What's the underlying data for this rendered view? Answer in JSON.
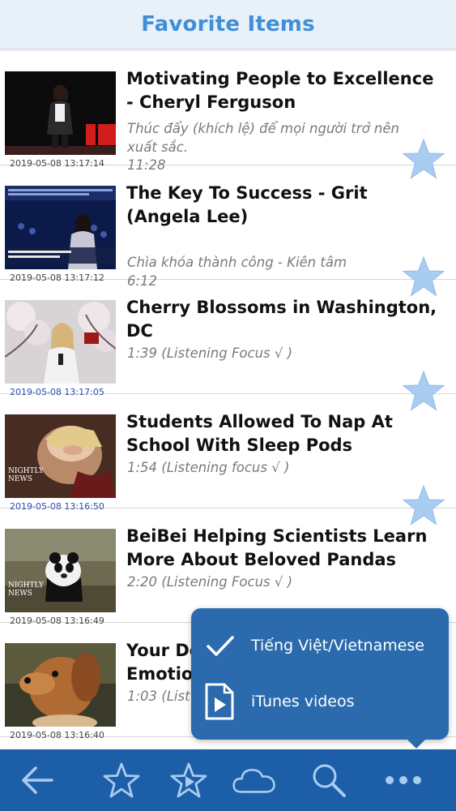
{
  "header": {
    "title": "Favorite Items"
  },
  "items": [
    {
      "title": "Motivating People to Excellence - Cheryl Ferguson",
      "subtitle": "Thúc đẩy (khích lệ) để mọi người trở nên xuất sắc.",
      "duration": "11:28",
      "date": "2019-05-08 13:17:14",
      "date_color": "gray",
      "thumbnail": "ted-speaker-red-stage"
    },
    {
      "title": "The Key To Success - Grit (Angela Lee)",
      "subtitle": "Chìa khóa thành công - Kiên tâm",
      "duration": "6:12",
      "date": "2019-05-08 13:17:12",
      "date_color": "gray",
      "thumbnail": "ted-speaker-blue-stage"
    },
    {
      "title": "Cherry Blossoms in Washington, DC",
      "subtitle": "1:39 (Listening Focus  √ )",
      "date": "2019-05-08 13:17:05",
      "date_color": "blue",
      "thumbnail": "reporter-cherry-blossoms"
    },
    {
      "title": "Students Allowed To Nap At School With Sleep Pods",
      "subtitle": "1:54 (Listening focus  √ )",
      "date": "2019-05-08 13:16:50",
      "date_color": "blue",
      "thumbnail": "student-sleep-pod",
      "logo_text": [
        "NIGHTLY",
        "NEWS"
      ]
    },
    {
      "title": "BeiBei Helping Scientists Learn More About Beloved Pandas",
      "subtitle": "2:20 (Listening Focus  √ )",
      "date": "2019-05-08 13:16:49",
      "date_color": "gray",
      "thumbnail": "panda",
      "logo_text": [
        "NIGHTLY",
        "NEWS"
      ]
    },
    {
      "title": "Your Do",
      "title_line2": "Emotio",
      "subtitle": "1:03 (List",
      "date": "2019-05-08 13:16:40",
      "date_color": "gray",
      "thumbnail": "dog"
    }
  ],
  "popover": {
    "items": [
      {
        "label": "Tiếng Việt/Vietnamese",
        "icon": "checkmark-icon"
      },
      {
        "label": "iTunes videos",
        "icon": "video-file-icon"
      }
    ]
  },
  "toolbar": {
    "buttons": [
      "back-arrow-icon",
      "star-outline-icon",
      "star-play-icon",
      "cloud-icon",
      "search-icon",
      "more-icon"
    ]
  },
  "colors": {
    "header_title": "#3f8fd8",
    "star_fill": "#a9cdf0",
    "toolbar_bg": "#1c5fa8",
    "popover_bg": "#2a6aad",
    "date_blue": "#2a4fae"
  }
}
